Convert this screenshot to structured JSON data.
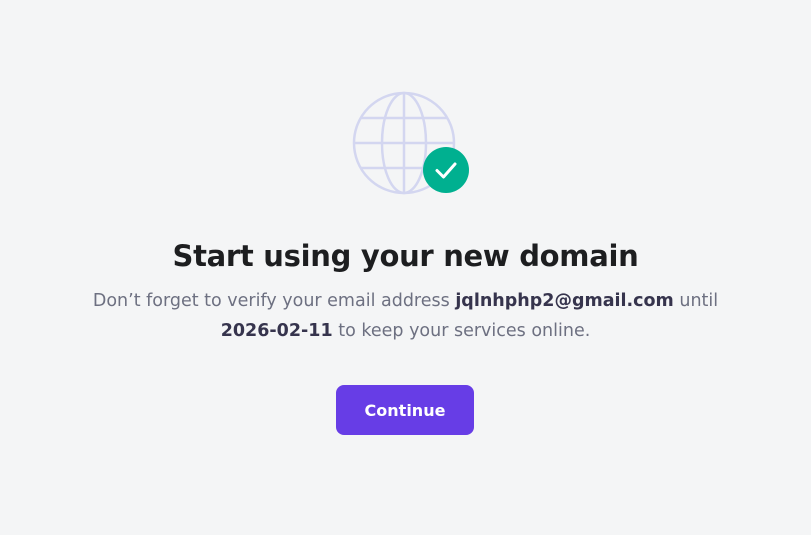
{
  "illustration": {
    "globe_icon": "globe-icon",
    "badge_icon": "check-icon",
    "globe_color": "#d3d6f0",
    "badge_color": "#00b090"
  },
  "main": {
    "title": "Start using your new domain",
    "desc_prefix": "Don’t forget to verify your email address ",
    "email": "jqlnhphp2@gmail.com",
    "desc_middle": " until ",
    "date": "2026-02-11",
    "desc_suffix": " to keep your services online."
  },
  "actions": {
    "continue_label": "Continue",
    "accent_color": "#673de6"
  }
}
